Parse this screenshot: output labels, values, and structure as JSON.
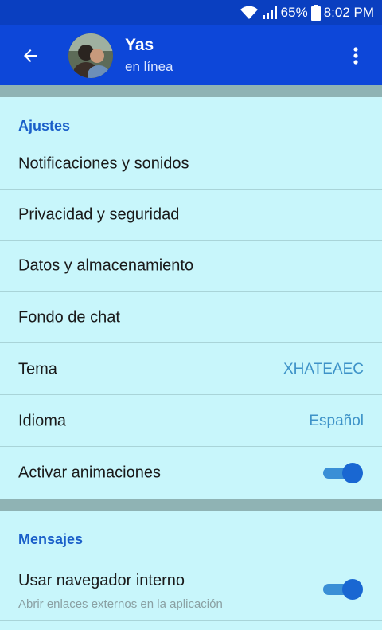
{
  "status_bar": {
    "battery": "65%",
    "time": "8:02 PM"
  },
  "header": {
    "name": "Yas",
    "status": "en línea"
  },
  "settings": {
    "title": "Ajustes",
    "items": [
      {
        "label": "Notificaciones y sonidos"
      },
      {
        "label": "Privacidad y seguridad"
      },
      {
        "label": "Datos y almacenamiento"
      },
      {
        "label": "Fondo de chat"
      },
      {
        "label": "Tema",
        "value": "XHATEAEC"
      },
      {
        "label": "Idioma",
        "value": "Español"
      },
      {
        "label": "Activar animaciones",
        "toggle": true
      }
    ]
  },
  "messages": {
    "title": "Mensajes",
    "items": [
      {
        "label": "Usar navegador interno",
        "sub": "Abrir enlaces externos en la aplicación",
        "toggle": true
      }
    ]
  },
  "colors": {
    "app_bar": "#0d47d9",
    "status_bar": "#0a3fc0",
    "background": "#c8f6fb",
    "accent": "#1967d2"
  },
  "icons": [
    "wifi-icon",
    "signal-icon",
    "battery-icon",
    "back-arrow-icon",
    "more-vert-icon"
  ]
}
